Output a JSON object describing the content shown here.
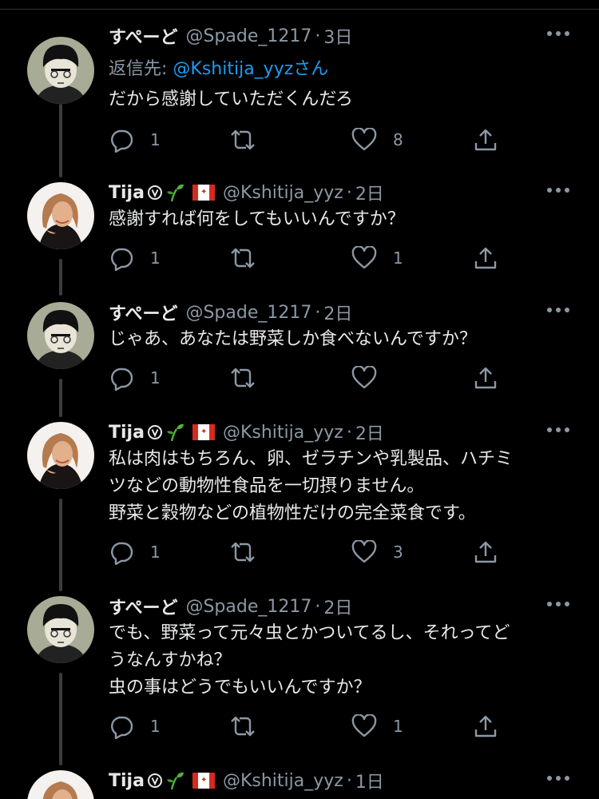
{
  "colors": {
    "background": "#000000",
    "text": "#e7e9ea",
    "secondary": "#8b98a5",
    "link": "#1d9bf0",
    "thread_line": "#3a3d40"
  },
  "icons": [
    "reply-icon",
    "retweet-icon",
    "like-icon",
    "share-icon",
    "more-icon",
    "verified-v-icon",
    "sprout-icon",
    "canada-flag-icon"
  ],
  "tweets": [
    {
      "name": "すぺーど",
      "handle": "@Spade_1217",
      "dot": "·",
      "time": "3日",
      "reply_label": "返信先: ",
      "reply_mention": "@Kshitija_yyzさん",
      "lines": [
        "だから感謝していただくんだろ"
      ],
      "reply_count": "1",
      "retweet_count": "",
      "like_count": "8"
    },
    {
      "name": "Tija",
      "handle": "@Kshitija_yyz",
      "dot": "·",
      "time": "2日",
      "lines": [
        "感謝すれば何をしてもいいんですか？"
      ],
      "reply_count": "1",
      "retweet_count": "",
      "like_count": "1"
    },
    {
      "name": "すぺーど",
      "handle": "@Spade_1217",
      "dot": "·",
      "time": "2日",
      "lines": [
        "じゃあ、あなたは野菜しか食べないんですか？"
      ],
      "reply_count": "1",
      "retweet_count": "",
      "like_count": ""
    },
    {
      "name": "Tija",
      "handle": "@Kshitija_yyz",
      "dot": "·",
      "time": "2日",
      "lines": [
        "私は肉はもちろん、卵、ゼラチンや乳製品、ハチミ",
        "ツなどの動物性食品を一切摂りません。",
        "野菜と穀物などの植物性だけの完全菜食です。"
      ],
      "reply_count": "1",
      "retweet_count": "",
      "like_count": "3"
    },
    {
      "name": "すぺーど",
      "handle": "@Spade_1217",
      "dot": "·",
      "time": "2日",
      "lines": [
        "でも、野菜って元々虫とかついてるし、それってど",
        "うなんすかね？",
        "虫の事はどうでもいいんですか？"
      ],
      "reply_count": "1",
      "retweet_count": "",
      "like_count": "1"
    },
    {
      "name": "Tija",
      "handle": "@Kshitija_yyz",
      "dot": "·",
      "time": "1日"
    }
  ]
}
